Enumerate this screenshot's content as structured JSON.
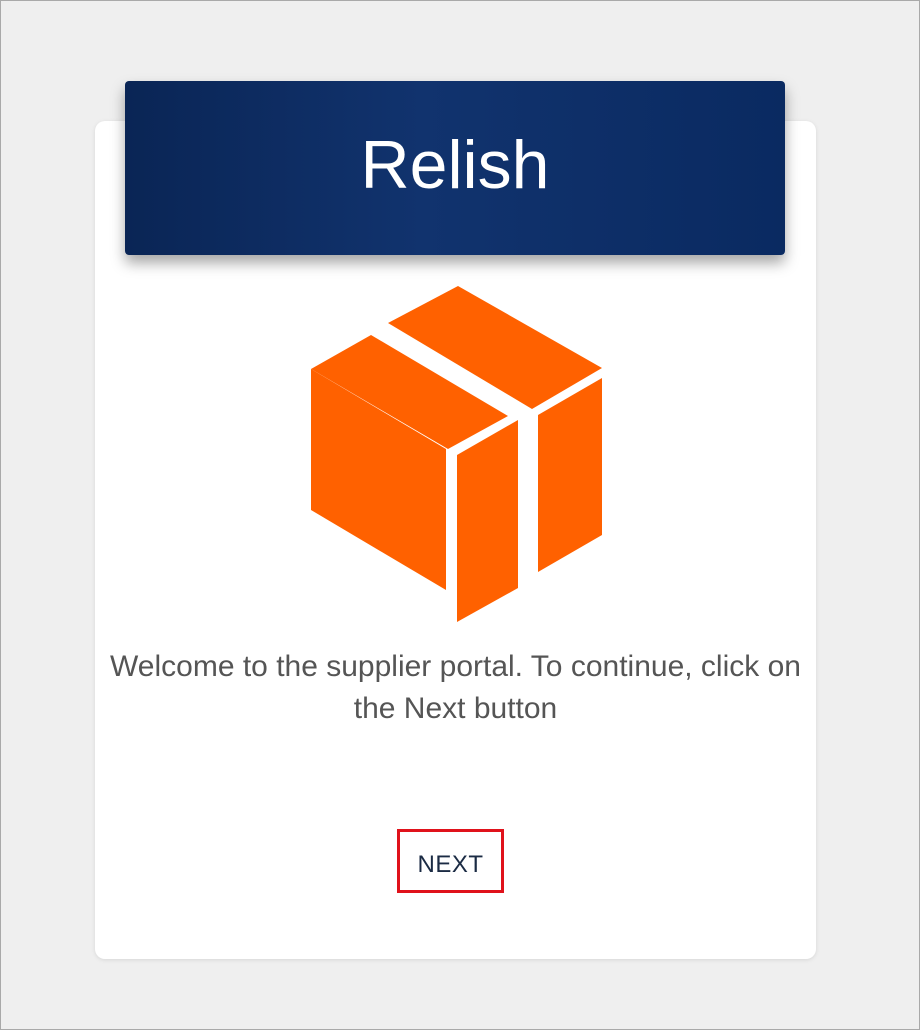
{
  "app": {
    "title": "Relish"
  },
  "content": {
    "welcome_text": "Welcome to the supplier portal. To continue, click on the Next button"
  },
  "actions": {
    "next_label": "NEXT"
  },
  "icons": {
    "logo": "box-logo-icon"
  },
  "colors": {
    "header_background": "#0b2b63",
    "logo_orange": "#ff6100",
    "highlight_border": "#e0121b",
    "page_background": "#efefef"
  }
}
